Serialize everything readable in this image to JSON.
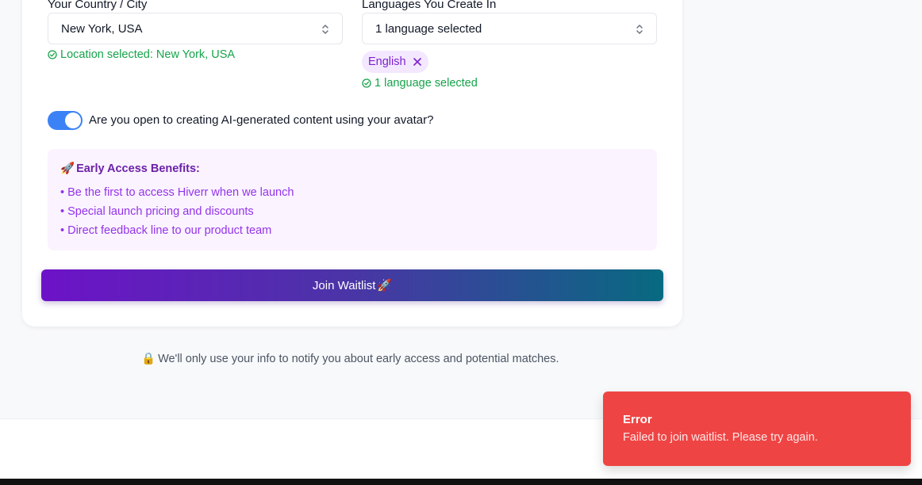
{
  "location": {
    "label": "Your Country / City",
    "value": "New York, USA",
    "status": "Location selected: New York, USA"
  },
  "languages": {
    "label": "Languages You Create In",
    "value": "1 language selected",
    "chips": [
      "English"
    ],
    "status": "1 language selected"
  },
  "ai_toggle": {
    "label": "Are you open to creating AI-generated content using your avatar?",
    "checked": true
  },
  "benefits": {
    "emoji": "🚀",
    "title": "Early Access Benefits:",
    "items": [
      "• Be the first to access Hiverr when we launch",
      "• Special launch pricing and discounts",
      "• Direct feedback line to our product team"
    ]
  },
  "join_button": {
    "label": "Join Waitlist",
    "emoji": "🚀"
  },
  "privacy": {
    "emoji": "🔒",
    "text": "We'll only use your info to notify you about early access and potential matches."
  },
  "toast": {
    "title": "Error",
    "message": "Failed to join waitlist. Please try again."
  },
  "colors": {
    "accent": "#3b82f6",
    "success": "#16a34a",
    "error": "#ef4444",
    "purple": "#7e22ce"
  }
}
